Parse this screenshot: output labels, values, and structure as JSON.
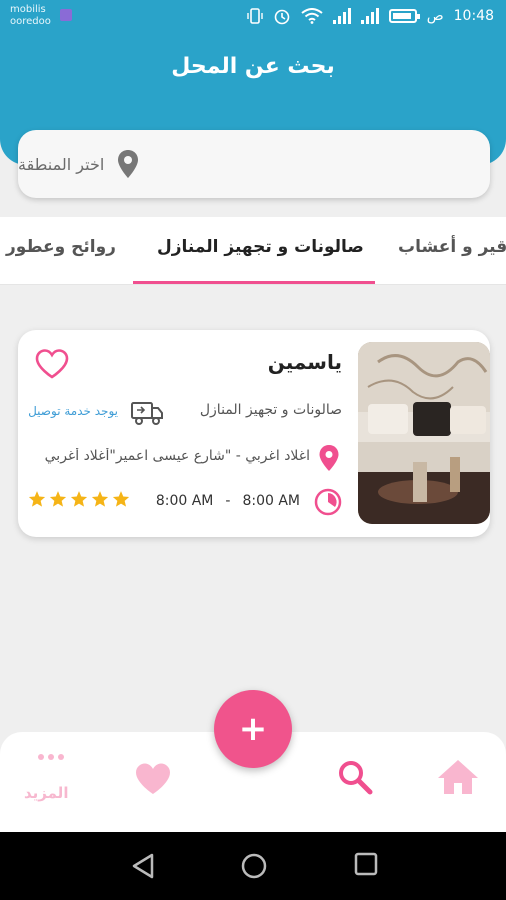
{
  "status_bar": {
    "carrier_line1": "mobilis",
    "carrier_line2": "ooredoo",
    "time": "10:48",
    "am_pm": "ص"
  },
  "header": {
    "title": "بحث عن المحل",
    "bg_color": "#2aa3c9"
  },
  "search": {
    "placeholder": "اختر المنطقة"
  },
  "tabs": [
    {
      "label": "روائح وعطور"
    },
    {
      "label": "صالونات و تجهيز المنازل",
      "active": true
    },
    {
      "label": "عقاقير و أعشاب"
    }
  ],
  "card": {
    "name": "ياسمين",
    "category": "صالونات و تجهيز المنازل",
    "delivery": "يوجد خدمة توصيل",
    "address": "اغلاد اغربي - \"شارع عيسى اعمير\"أغلاد أغربي",
    "hours_from": "8:00 AM",
    "hours_sep": "-",
    "hours_to": "8:00 AM",
    "rating": 5,
    "accent": "#f04f8f"
  },
  "nav": {
    "more_label": "المزيد",
    "fab_label": "+",
    "inactive_color": "#f9b6cf",
    "active_color": "#f04f8f"
  }
}
